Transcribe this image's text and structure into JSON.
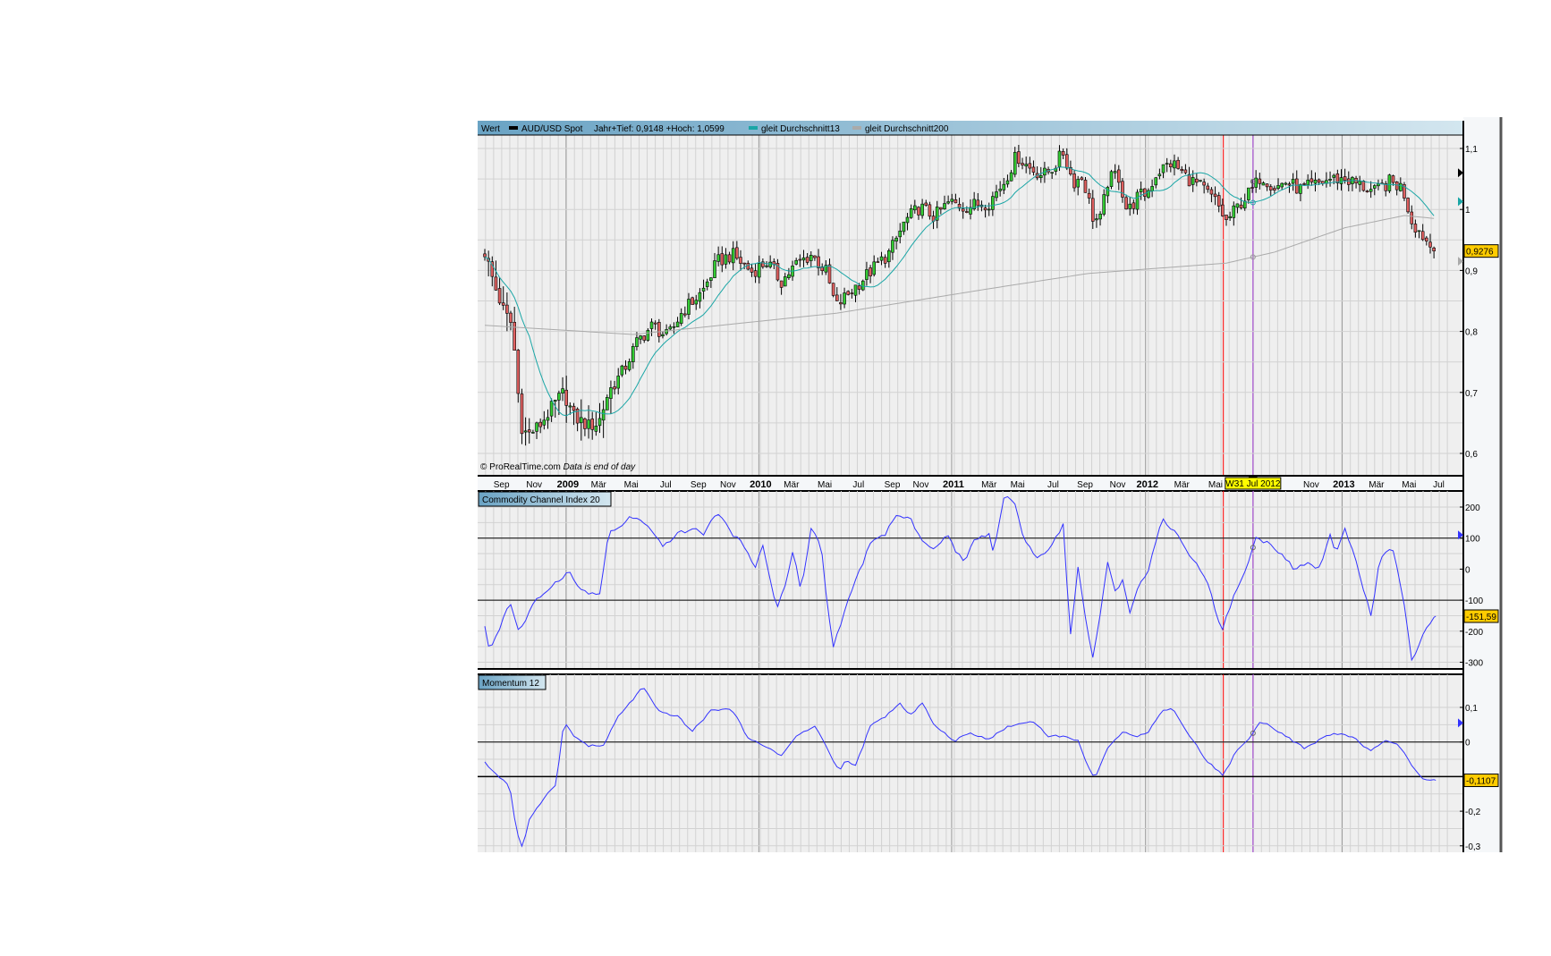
{
  "chart_data": [
    {
      "type": "candlestick",
      "title": "AUD/USD Spot",
      "header": {
        "value_label": "Wert",
        "instrument": "AUD/USD Spot",
        "range_text": "Jahr+Tief: 0,9148 +Hoch: 1,0599",
        "legend": [
          {
            "name": "gleit Durchschnitt13",
            "color": "#1aa6a6"
          },
          {
            "name": "gleit Durchschnitt200",
            "color": "#aaaaaa"
          }
        ]
      },
      "x_unit": "weeks since Aug 2008",
      "ylim": [
        0.6,
        1.1
      ],
      "y_ticks": [
        "1,1",
        "1",
        "0,9",
        "0,8",
        "0,7",
        "0,6"
      ],
      "y_tick_values": [
        1.1,
        1.0,
        0.9,
        0.8,
        0.7,
        0.6
      ],
      "last_value": "0,9276",
      "credit": "© ProRealTime.com",
      "credit_note": "Data is end of day",
      "close_keypoints": [
        [
          0,
          0.93
        ],
        [
          2.7,
          0.874
        ],
        [
          5.3,
          0.83
        ],
        [
          7.5,
          0.81
        ],
        [
          8.5,
          0.727
        ],
        [
          9.9,
          0.645
        ],
        [
          11.5,
          0.63
        ],
        [
          14.7,
          0.645
        ],
        [
          18.7,
          0.68
        ],
        [
          21.3,
          0.7
        ],
        [
          24,
          0.66
        ],
        [
          28,
          0.645
        ],
        [
          30.7,
          0.65
        ],
        [
          33.3,
          0.7
        ],
        [
          37.3,
          0.735
        ],
        [
          41.3,
          0.785
        ],
        [
          45.3,
          0.81
        ],
        [
          49.3,
          0.79
        ],
        [
          53.3,
          0.833
        ],
        [
          58.7,
          0.865
        ],
        [
          62.7,
          0.914
        ],
        [
          66.7,
          0.926
        ],
        [
          72,
          0.898
        ],
        [
          76,
          0.914
        ],
        [
          80,
          0.882
        ],
        [
          84,
          0.91
        ],
        [
          88,
          0.926
        ],
        [
          92,
          0.898
        ],
        [
          94.7,
          0.84
        ],
        [
          97.3,
          0.857
        ],
        [
          101.3,
          0.882
        ],
        [
          105.3,
          0.906
        ],
        [
          109.3,
          0.93
        ],
        [
          113.3,
          0.98
        ],
        [
          117.3,
          1.004
        ],
        [
          121.3,
          0.988
        ],
        [
          125.3,
          1.012
        ],
        [
          129.3,
          1.004
        ],
        [
          136,
          1.012
        ],
        [
          140,
          1.045
        ],
        [
          143.5,
          1.089
        ],
        [
          146.7,
          1.069
        ],
        [
          150.7,
          1.056
        ],
        [
          153.3,
          1.069
        ],
        [
          156,
          1.093
        ],
        [
          158.7,
          1.045
        ],
        [
          161.3,
          1.053
        ],
        [
          164,
          0.988
        ],
        [
          165.9,
          0.98
        ],
        [
          168,
          1.045
        ],
        [
          170.7,
          1.061
        ],
        [
          173.3,
          0.995
        ],
        [
          176,
          1.02
        ],
        [
          178.7,
          1.028
        ],
        [
          181.3,
          1.061
        ],
        [
          185.3,
          1.077
        ],
        [
          189.3,
          1.053
        ],
        [
          193.3,
          1.036
        ],
        [
          197.3,
          1.012
        ],
        [
          200,
          0.98
        ],
        [
          204,
          1.012
        ],
        [
          207.5,
          1.036
        ],
        [
          209.3,
          1.056
        ],
        [
          213.3,
          1.036
        ],
        [
          216,
          1.045
        ],
        [
          220,
          1.033
        ],
        [
          224,
          1.04
        ],
        [
          228,
          1.05
        ],
        [
          232,
          1.05
        ],
        [
          236,
          1.04
        ],
        [
          240,
          1.028
        ],
        [
          244,
          1.045
        ],
        [
          247.5,
          1.036
        ],
        [
          250.1,
          0.98
        ],
        [
          253.3,
          0.955
        ],
        [
          256.5,
          0.9276
        ]
      ],
      "sma200_keypoints": [
        [
          0,
          0.81
        ],
        [
          40,
          0.795
        ],
        [
          95,
          0.83
        ],
        [
          136,
          0.87
        ],
        [
          162.7,
          0.895
        ],
        [
          200,
          0.912
        ],
        [
          213,
          0.93
        ],
        [
          232,
          0.97
        ],
        [
          248,
          0.99
        ],
        [
          256.5,
          0.985
        ]
      ],
      "x_labels": [
        {
          "label": "Sep",
          "week": 4.5
        },
        {
          "label": "Nov",
          "week": 13.3
        },
        {
          "label": "2009",
          "week": 22.4,
          "year": true
        },
        {
          "label": "Mär",
          "week": 30.7
        },
        {
          "label": "Mai",
          "week": 39.5
        },
        {
          "label": "Jul",
          "week": 48.8
        },
        {
          "label": "Sep",
          "week": 57.6
        },
        {
          "label": "Nov",
          "week": 65.6
        },
        {
          "label": "2010",
          "week": 74.4,
          "year": true
        },
        {
          "label": "Mär",
          "week": 82.7
        },
        {
          "label": "Mai",
          "week": 91.7
        },
        {
          "label": "Jul",
          "week": 100.8
        },
        {
          "label": "Sep",
          "week": 109.9
        },
        {
          "label": "Nov",
          "week": 117.6
        },
        {
          "label": "2011",
          "week": 126.4,
          "year": true
        },
        {
          "label": "Mär",
          "week": 136
        },
        {
          "label": "Mai",
          "week": 143.7
        },
        {
          "label": "Jul",
          "week": 153.3
        },
        {
          "label": "Sep",
          "week": 161.9
        },
        {
          "label": "Nov",
          "week": 170.7
        },
        {
          "label": "2012",
          "week": 178.7,
          "year": true
        },
        {
          "label": "Mär",
          "week": 188
        },
        {
          "label": "Mai",
          "week": 197.1
        },
        {
          "label": "Nov",
          "week": 222.9
        },
        {
          "label": "2013",
          "week": 231.7,
          "year": true
        },
        {
          "label": "Mär",
          "week": 240.5
        },
        {
          "label": "Mai",
          "week": 249.3
        },
        {
          "label": "Jul",
          "week": 257.3
        }
      ],
      "cursor": {
        "label": "W31 Jul 2012",
        "week": 207.2,
        "color": "#9933cc"
      },
      "marker_line": {
        "week": 199.2,
        "color": "#ff0000"
      }
    },
    {
      "type": "line",
      "title": "Commodity Channel Index 20",
      "ylim": [
        -300,
        200
      ],
      "y_ticks": [
        "200",
        "100",
        "0",
        "-100",
        "-200",
        "-300"
      ],
      "y_tick_values": [
        200,
        100,
        0,
        -100,
        -200,
        -300
      ],
      "reference_lines": [
        100,
        -100
      ],
      "last_value": "-151,59",
      "color": "#3333ff",
      "keypoints": [
        [
          0,
          -189
        ],
        [
          1.3,
          -262
        ],
        [
          4,
          -189
        ],
        [
          6.7,
          -103
        ],
        [
          9.3,
          -204
        ],
        [
          13.3,
          -109
        ],
        [
          17.3,
          -61
        ],
        [
          22.7,
          -7
        ],
        [
          25.3,
          -61
        ],
        [
          29.3,
          -83
        ],
        [
          31.2,
          -77
        ],
        [
          33.3,
          114
        ],
        [
          36,
          130
        ],
        [
          39.5,
          171
        ],
        [
          43.2,
          146
        ],
        [
          48,
          73
        ],
        [
          52,
          114
        ],
        [
          56,
          130
        ],
        [
          59.2,
          114
        ],
        [
          62.7,
          187
        ],
        [
          66.7,
          114
        ],
        [
          70.7,
          66
        ],
        [
          73.3,
          -7
        ],
        [
          74.7,
          89
        ],
        [
          78.7,
          -125
        ],
        [
          81.3,
          -45
        ],
        [
          83.2,
          66
        ],
        [
          85.3,
          -77
        ],
        [
          88,
          130
        ],
        [
          90.7,
          82
        ],
        [
          92,
          -77
        ],
        [
          93.9,
          -252
        ],
        [
          96.5,
          -156
        ],
        [
          98.7,
          -77
        ],
        [
          104,
          82
        ],
        [
          108,
          114
        ],
        [
          110.7,
          171
        ],
        [
          114.7,
          162
        ],
        [
          118.7,
          82
        ],
        [
          121.3,
          63
        ],
        [
          125.3,
          114
        ],
        [
          126.7,
          66
        ],
        [
          129.3,
          18
        ],
        [
          132,
          98
        ],
        [
          136,
          114
        ],
        [
          137.3,
          50
        ],
        [
          140,
          232
        ],
        [
          142.7,
          226
        ],
        [
          145.3,
          98
        ],
        [
          149.3,
          34
        ],
        [
          153.3,
          82
        ],
        [
          156,
          146
        ],
        [
          157.9,
          -220
        ],
        [
          160,
          3
        ],
        [
          162.7,
          -204
        ],
        [
          164,
          -284
        ],
        [
          165.9,
          -156
        ],
        [
          168,
          18
        ],
        [
          170.1,
          -77
        ],
        [
          172,
          -29
        ],
        [
          173.9,
          -140
        ],
        [
          176,
          -61
        ],
        [
          178.7,
          -13
        ],
        [
          182.7,
          162
        ],
        [
          186.7,
          114
        ],
        [
          190.7,
          34
        ],
        [
          194.7,
          -29
        ],
        [
          198.7,
          -204
        ],
        [
          201.3,
          -109
        ],
        [
          205.3,
          2
        ],
        [
          208,
          98
        ],
        [
          212,
          82
        ],
        [
          214.7,
          50
        ],
        [
          218.7,
          -4
        ],
        [
          221.3,
          18
        ],
        [
          225.3,
          2
        ],
        [
          228,
          114
        ],
        [
          229.3,
          50
        ],
        [
          232,
          130
        ],
        [
          234.7,
          34
        ],
        [
          237.3,
          -77
        ],
        [
          239.2,
          -156
        ],
        [
          241.3,
          34
        ],
        [
          244.8,
          66
        ],
        [
          247.5,
          -77
        ],
        [
          250.1,
          -300
        ],
        [
          253.3,
          -204
        ],
        [
          256.5,
          -151.59
        ]
      ]
    },
    {
      "type": "line",
      "title": "Momentum 12",
      "ylim": [
        -0.3,
        0.1
      ],
      "y_ticks": [
        "0,1",
        "0",
        "-0,2",
        "-0,3"
      ],
      "y_tick_values": [
        0.1,
        0,
        -0.2,
        -0.3
      ],
      "reference_lines": [
        0,
        -0.1
      ],
      "last_value": "-0,1107",
      "color": "#3333ff",
      "keypoints": [
        [
          0,
          -0.06
        ],
        [
          2.7,
          -0.089
        ],
        [
          6.7,
          -0.126
        ],
        [
          8.5,
          -0.254
        ],
        [
          10.1,
          -0.306
        ],
        [
          12,
          -0.226
        ],
        [
          14.7,
          -0.183
        ],
        [
          17.3,
          -0.14
        ],
        [
          19.2,
          -0.126
        ],
        [
          21.3,
          0.06
        ],
        [
          24,
          0.017
        ],
        [
          28,
          -0.011
        ],
        [
          32,
          -0.011
        ],
        [
          36,
          0.074
        ],
        [
          39.5,
          0.117
        ],
        [
          42.7,
          0.16
        ],
        [
          46.7,
          0.089
        ],
        [
          52,
          0.074
        ],
        [
          56,
          0.031
        ],
        [
          61.3,
          0.094
        ],
        [
          66.7,
          0.094
        ],
        [
          70.7,
          0.017
        ],
        [
          74.7,
          -0.011
        ],
        [
          77.3,
          -0.02
        ],
        [
          80,
          -0.04
        ],
        [
          84,
          0.017
        ],
        [
          89.3,
          0.046
        ],
        [
          93.3,
          -0.04
        ],
        [
          95.5,
          -0.083
        ],
        [
          97.3,
          -0.054
        ],
        [
          100,
          -0.069
        ],
        [
          104,
          0.046
        ],
        [
          108,
          0.074
        ],
        [
          112,
          0.111
        ],
        [
          114.7,
          0.074
        ],
        [
          117.9,
          0.117
        ],
        [
          121.3,
          0.046
        ],
        [
          126.7,
          0.003
        ],
        [
          130.7,
          0.026
        ],
        [
          136,
          0.009
        ],
        [
          141.3,
          0.046
        ],
        [
          148,
          0.06
        ],
        [
          152,
          0.017
        ],
        [
          156,
          0.017
        ],
        [
          160,
          0.003
        ],
        [
          162.7,
          -0.069
        ],
        [
          164.5,
          -0.106
        ],
        [
          168,
          -0.02
        ],
        [
          172,
          0.031
        ],
        [
          176,
          0.017
        ],
        [
          178.7,
          0.026
        ],
        [
          182.7,
          0.089
        ],
        [
          185.3,
          0.1
        ],
        [
          189.3,
          0.031
        ],
        [
          194.7,
          -0.054
        ],
        [
          199.2,
          -0.097
        ],
        [
          202.7,
          -0.026
        ],
        [
          206.7,
          0.017
        ],
        [
          209.3,
          0.06
        ],
        [
          212,
          0.046
        ],
        [
          216,
          0.017
        ],
        [
          221.3,
          -0.02
        ],
        [
          226.7,
          0.017
        ],
        [
          230.7,
          0.026
        ],
        [
          234.7,
          0.009
        ],
        [
          238.7,
          -0.026
        ],
        [
          242.7,
          0.003
        ],
        [
          246.7,
          -0.011
        ],
        [
          250.1,
          -0.069
        ],
        [
          253.3,
          -0.111
        ],
        [
          256.5,
          -0.1107
        ]
      ]
    }
  ],
  "colors": {
    "up": "#33cc33",
    "down": "#e06060",
    "plot_bg": "#efefef",
    "grid": "#d2d2d2",
    "axis_bg": "#f5f7f9",
    "value_box": "#ffcc00",
    "cursor_box": "#ffff00"
  }
}
